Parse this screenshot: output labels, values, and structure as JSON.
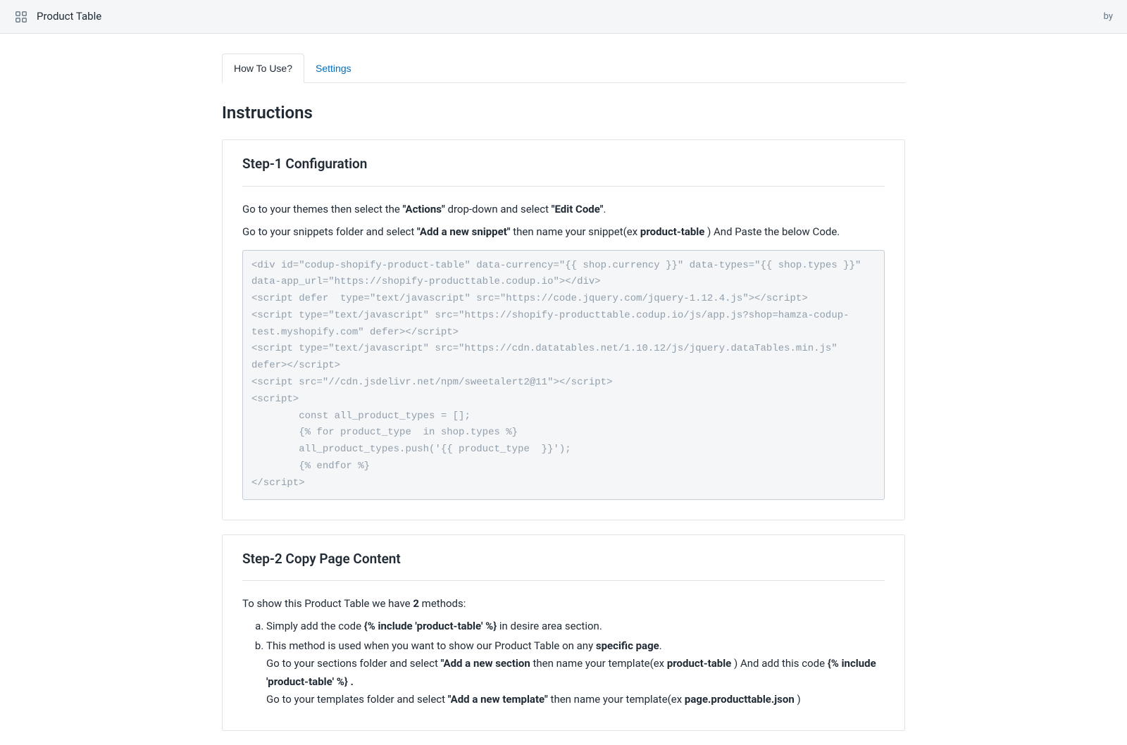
{
  "header": {
    "app_title": "Product Table",
    "by_text": "by"
  },
  "tabs": {
    "how_to_use": "How To Use?",
    "settings": "Settings"
  },
  "page": {
    "title": "Instructions"
  },
  "step1": {
    "title": "Step-1 Configuration",
    "line1_before": "Go to your themes then select the ",
    "line1_bold1": "\"Actions\"",
    "line1_mid": " drop-down and select ",
    "line1_bold2": "\"Edit Code\"",
    "line1_after": ".",
    "line2_before": "Go to your snippets folder and select ",
    "line2_bold1": "\"Add a new snippet\"",
    "line2_mid": " then name your snippet(ex ",
    "line2_bold2": "product-table",
    "line2_after": " ) And Paste the below Code.",
    "code": "<div id=\"codup-shopify-product-table\" data-currency=\"{{ shop.currency }}\" data-types=\"{{ shop.types }}\" data-app_url=\"https://shopify-producttable.codup.io\"></div>\n<script defer  type=\"text/javascript\" src=\"https://code.jquery.com/jquery-1.12.4.js\"></script>\n<script type=\"text/javascript\" src=\"https://shopify-producttable.codup.io/js/app.js?shop=hamza-codup-test.myshopify.com\" defer></script>\n<script type=\"text/javascript\" src=\"https://cdn.datatables.net/1.10.12/js/jquery.dataTables.min.js\" defer></script>\n<script src=\"//cdn.jsdelivr.net/npm/sweetalert2@11\"></script>\n<script>\n        const all_product_types = [];\n        {% for product_type  in shop.types %}\n        all_product_types.push('{{ product_type  }}');\n        {% endfor %}\n</script>"
  },
  "step2": {
    "title": "Step-2 Copy Page Content",
    "intro_before": "To show this Product Table we have ",
    "intro_bold": "2",
    "intro_after": " methods:",
    "method_a_before": "Simply add the code ",
    "method_a_bold": "{% include 'product-table' %}",
    "method_a_after": " in desire area section.",
    "method_b_before": "This method is used when you want to show our Product Table on any ",
    "method_b_bold": "specific page",
    "method_b_after": ".",
    "method_b_sub1_before": "Go to your sections folder and select ",
    "method_b_sub1_bold1": "\"Add a new section",
    "method_b_sub1_mid": " then name your template(ex ",
    "method_b_sub1_bold2": "product-table",
    "method_b_sub1_mid2": " ) And add this code ",
    "method_b_sub1_bold3": "{% include 'product-table' %} .",
    "method_b_sub2_before": "Go to your templates folder and select ",
    "method_b_sub2_bold1": "\"Add a new template\"",
    "method_b_sub2_mid": " then name your template(ex ",
    "method_b_sub2_bold2": "page.producttable.json",
    "method_b_sub2_after": " )"
  }
}
